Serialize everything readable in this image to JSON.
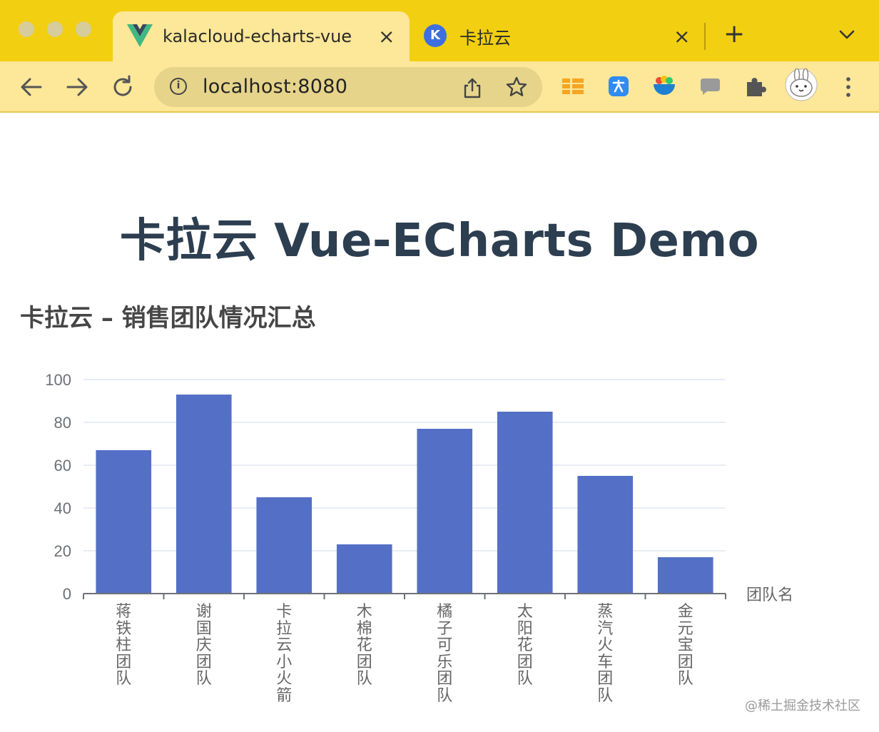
{
  "browser": {
    "active_tab": {
      "title": "kalacloud-echarts-vue",
      "icon": "vue-logo-icon"
    },
    "inactive_tab": {
      "title": "卡拉云",
      "icon": "kalacloud-logo-icon"
    },
    "close_glyph": "×",
    "new_tab_glyph": "+",
    "address": {
      "url": "localhost:8080",
      "info_glyph": "i"
    },
    "extensions": [
      "grid-extension-icon",
      "translate-extension-icon",
      "bowl-extension-icon",
      "chat-extension-icon",
      "puzzle-extension-icon",
      "bunny-avatar-icon"
    ],
    "colors": {
      "tabstrip": "#f2cf10",
      "toolbar": "#fde798",
      "omnibox": "#e5d48a"
    }
  },
  "page": {
    "title": "卡拉云 Vue-ECharts Demo",
    "title_color": "#2c3e50"
  },
  "chart_data": {
    "type": "bar",
    "title": "卡拉云 – 销售团队情况汇总",
    "xlabel": "团队名",
    "ylabel": "",
    "categories": [
      "蒋铁柱团队",
      "谢国庆团队",
      "卡拉云小火箭",
      "木棉花团队",
      "橘子可乐团队",
      "太阳花团队",
      "蒸汽火车团队",
      "金元宝团队"
    ],
    "values": [
      67,
      93,
      45,
      23,
      77,
      85,
      55,
      17
    ],
    "ylim": [
      0,
      100
    ],
    "yticks": [
      "0",
      "20",
      "40",
      "60",
      "80",
      "100"
    ],
    "grid": true,
    "bar_color": "#5470c6",
    "label_orientation": "vertical"
  },
  "watermark": "@稀土掘金技术社区"
}
